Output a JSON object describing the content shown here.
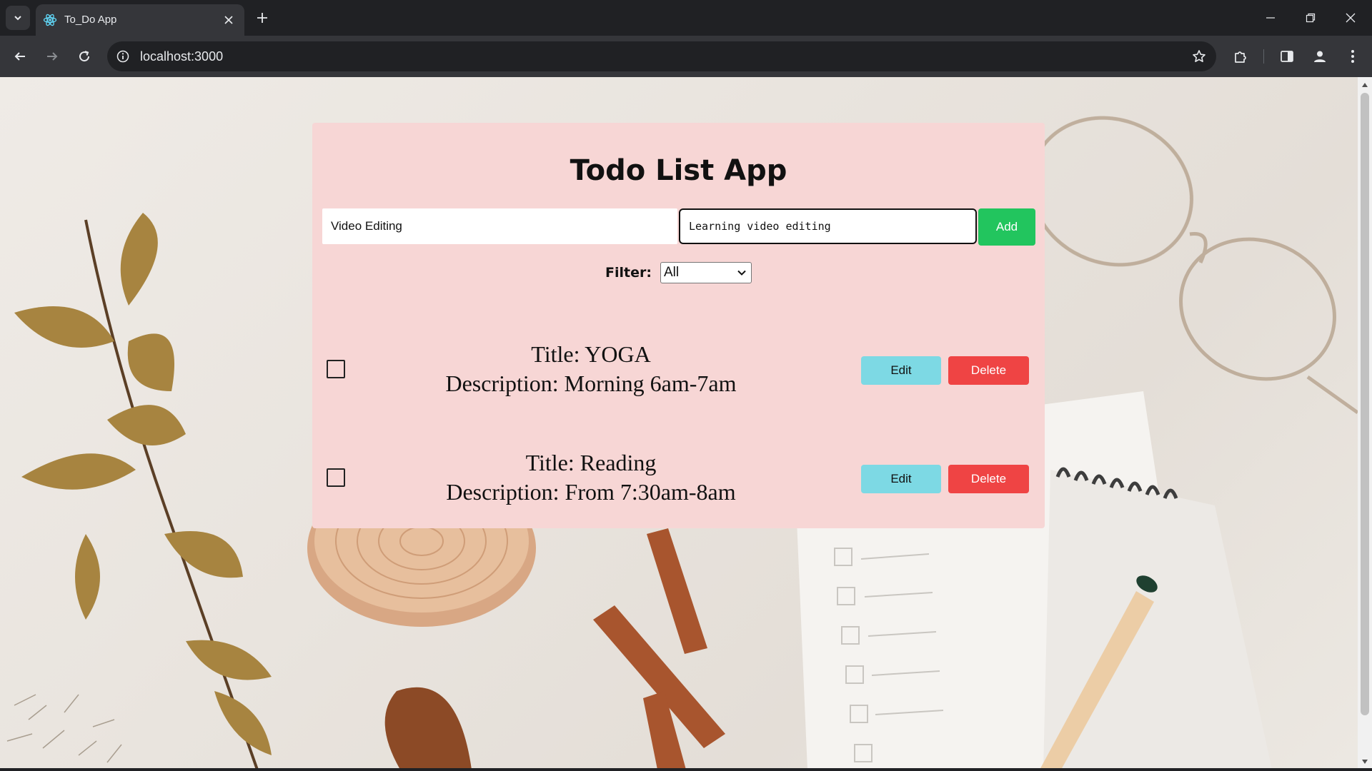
{
  "browser": {
    "tab_title": "To_Do App",
    "url": "localhost:3000",
    "icons": {
      "tab_search": "chevron-down-icon",
      "favicon": "react-icon",
      "tab_close": "close-icon",
      "new_tab": "plus-icon",
      "back": "arrow-left-icon",
      "forward": "arrow-right-icon",
      "reload": "reload-icon",
      "site_info": "info-icon",
      "bookmark": "star-icon",
      "extensions": "puzzle-icon",
      "side_panel": "side-panel-icon",
      "profile": "profile-icon",
      "menu": "kebab-icon"
    }
  },
  "app": {
    "title": "Todo List App",
    "title_input": {
      "value": "Video Editing"
    },
    "description_input": {
      "value": "Learning video editing"
    },
    "add_label": "Add",
    "filter": {
      "label": "Filter:",
      "selected": "All"
    },
    "todos": [
      {
        "title": "Title: YOGA",
        "description": "Description: Morning 6am-7am",
        "checked": false,
        "edit_label": "Edit",
        "delete_label": "Delete"
      },
      {
        "title": "Title: Reading",
        "description": "Description: From 7:30am-8am",
        "checked": false,
        "edit_label": "Edit",
        "delete_label": "Delete"
      }
    ],
    "colors": {
      "card": "#f7d6d5",
      "add": "#22c55e",
      "edit": "#7dd9e4",
      "delete": "#ef4444"
    }
  }
}
